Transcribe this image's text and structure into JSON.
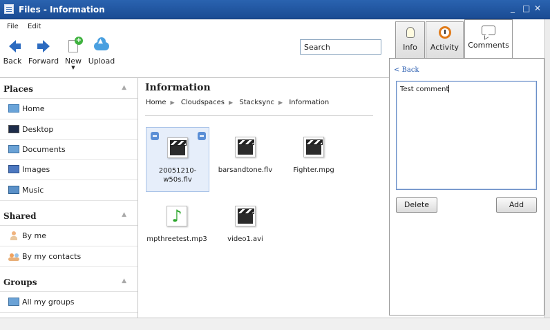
{
  "window": {
    "title": "Files - Information",
    "controls": [
      "_",
      "□",
      "✕"
    ]
  },
  "menu": {
    "items": [
      "File",
      "Edit"
    ]
  },
  "toolbar": {
    "back_label": "Back",
    "forward_label": "Forward",
    "new_label": "New",
    "upload_label": "Upload"
  },
  "search": {
    "value": "Search"
  },
  "sidebar": {
    "places": {
      "title": "Places",
      "items": [
        "Home",
        "Desktop",
        "Documents",
        "Images",
        "Music"
      ]
    },
    "shared": {
      "title": "Shared",
      "items": [
        "By me",
        "By my contacts"
      ]
    },
    "groups": {
      "title": "Groups",
      "items": [
        "All my groups"
      ]
    }
  },
  "main": {
    "title": "Information",
    "breadcrumb": [
      "Home",
      "Cloudspaces",
      "Stacksync",
      "Information"
    ],
    "files": [
      {
        "name_line1": "20051210-",
        "name_line2": "w50s.flv",
        "type": "video",
        "selected": true
      },
      {
        "name_line1": "barsandtone.flv",
        "name_line2": "",
        "type": "video"
      },
      {
        "name_line1": "Fighter.mpg",
        "name_line2": "",
        "type": "video"
      },
      {
        "name_line1": "mpthreetest.mp3",
        "name_line2": "",
        "type": "audio"
      },
      {
        "name_line1": "video1.avi",
        "name_line2": "",
        "type": "video"
      }
    ]
  },
  "details": {
    "tabs": [
      "Info",
      "Activity",
      "Comments"
    ],
    "active_tab": "Comments",
    "back_label": "< Back",
    "comment_value": "Test comment",
    "delete_label": "Delete",
    "add_label": "Add"
  },
  "colors": {
    "titlebar": "#1f56a3",
    "accent": "#2a5db0"
  }
}
